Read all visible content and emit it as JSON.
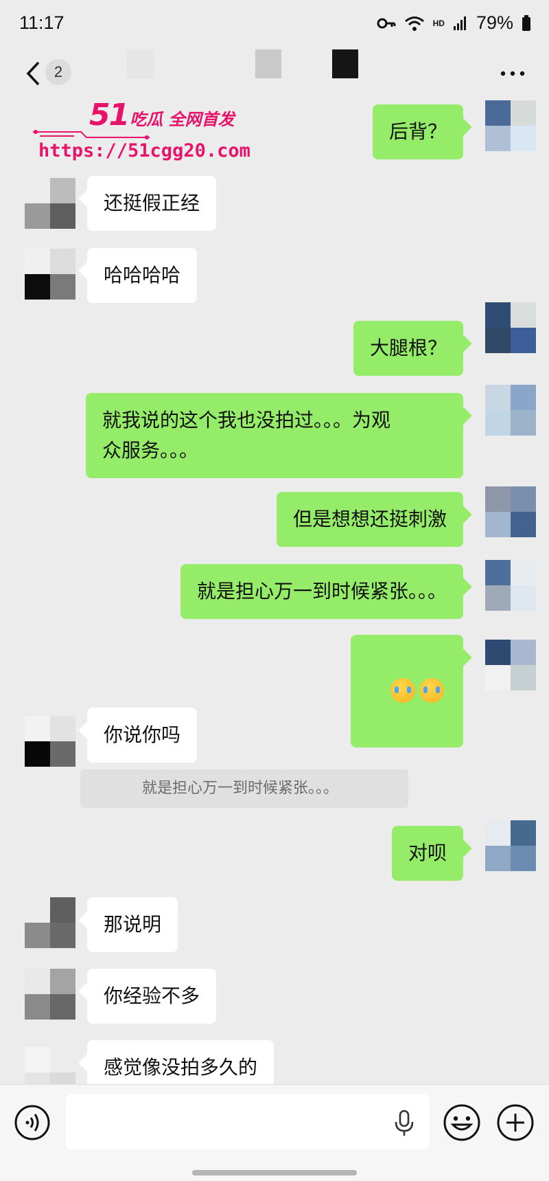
{
  "status_bar": {
    "time": "11:17",
    "hd_label": "HD",
    "battery_percent": "79%",
    "icons": [
      "key-icon",
      "wifi-icon",
      "signal-icon",
      "battery-icon"
    ]
  },
  "nav": {
    "unread_count": "2",
    "back_icon": "chevron-left-icon",
    "more_icon": "more-dots-icon"
  },
  "watermark": {
    "brand_number": "51",
    "brand_text": "吃瓜 全网首发",
    "url": "https://51cgg20.com"
  },
  "messages": [
    {
      "side": "right",
      "text": "后背？"
    },
    {
      "side": "left",
      "text": "还挺假正经"
    },
    {
      "side": "left",
      "text": "哈哈哈哈"
    },
    {
      "side": "right",
      "text": "大腿根？"
    },
    {
      "side": "right",
      "text": "就我说的这个我也没拍过。。。为观\n众服务。。。"
    },
    {
      "side": "right",
      "text": "但是想想还挺刺激"
    },
    {
      "side": "right",
      "text": "就是担心万一到时候紧张。。。"
    },
    {
      "side": "right",
      "emoji": [
        "face-with-tears-of-joy-emoji",
        "face-with-tears-of-joy-emoji"
      ]
    },
    {
      "side": "left",
      "text": "你说你吗",
      "quote": "就是担心万一到时候紧张。。。"
    },
    {
      "side": "right",
      "text": "对呗"
    },
    {
      "side": "left",
      "text": "那说明"
    },
    {
      "side": "left",
      "text": "你经验不多"
    },
    {
      "side": "left",
      "text": "感觉像没拍多久的"
    }
  ],
  "input_bar": {
    "placeholder": "",
    "icons": [
      "voice-icon",
      "microphone-icon",
      "emoji-icon",
      "plus-icon"
    ]
  },
  "colors": {
    "background": "#ececec",
    "outgoing_bubble": "#95ec69",
    "incoming_bubble": "#ffffff",
    "watermark": "#e8126b"
  }
}
